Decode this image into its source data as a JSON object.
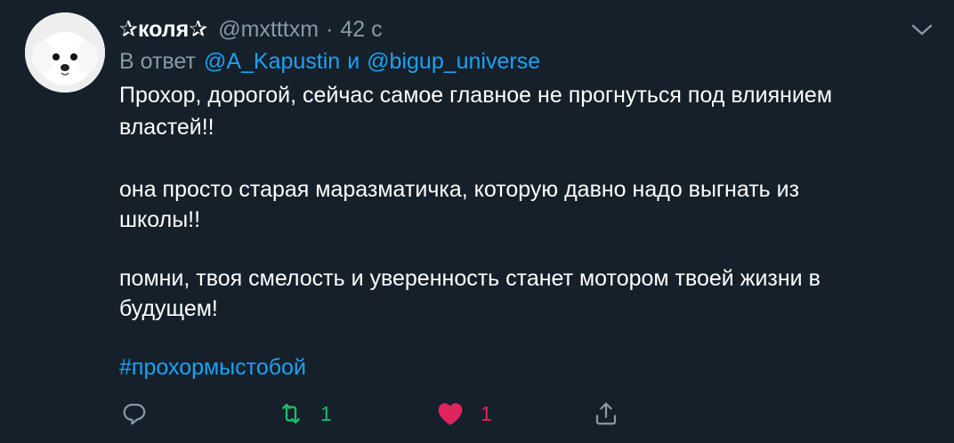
{
  "tweet": {
    "display_name": "✰коля✰",
    "handle": "@mxtttxm",
    "separator": "·",
    "time": "42 с",
    "reply_prefix": "В ответ",
    "reply_mentions": [
      "@A_Kapustin",
      "@bigup_universe"
    ],
    "reply_conjunction": "и",
    "body_lines": [
      "Прохор, дорогой, сейчас самое главное не прогнуться под влиянием",
      "властей!!",
      "она просто старая маразматичка, которую давно надо выгнать из",
      "школы!!",
      "помни, твоя смелость и уверенность станет мотором твоей жизни в",
      "будущем!"
    ],
    "hashtag": "#прохормыстобой"
  },
  "actions": {
    "reply": {
      "icon": "reply-icon",
      "count": ""
    },
    "retweet": {
      "icon": "retweet-icon",
      "count": "1",
      "color": "#17bf63"
    },
    "like": {
      "icon": "heart-icon",
      "count": "1",
      "color": "#e0245e"
    },
    "share": {
      "icon": "share-icon",
      "count": ""
    }
  },
  "colors": {
    "background": "#15202b",
    "secondary_text": "#8899a6",
    "link": "#1da1f2"
  }
}
